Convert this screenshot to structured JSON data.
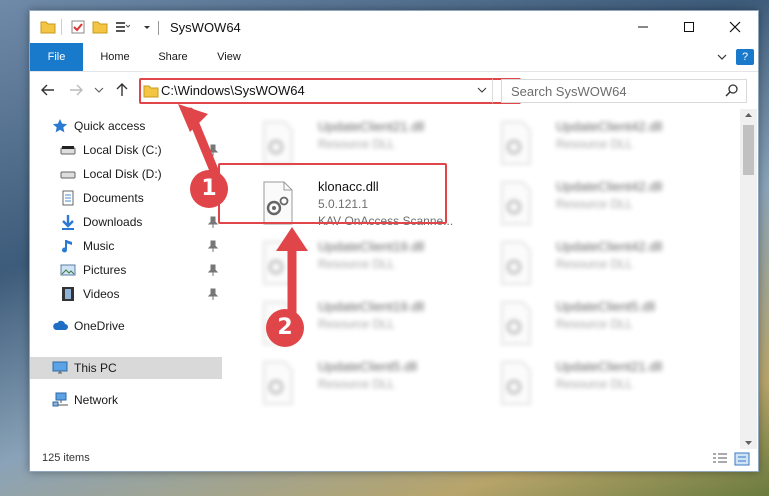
{
  "window": {
    "title": "SysWOW64"
  },
  "ribbon": {
    "tabs": [
      {
        "label": "File"
      },
      {
        "label": "Home"
      },
      {
        "label": "Share"
      },
      {
        "label": "View"
      }
    ],
    "help": "?"
  },
  "nav": {
    "address": "C:\\Windows\\SysWOW64",
    "search_placeholder": "Search SysWOW64"
  },
  "sidebar": {
    "items": [
      {
        "label": "Quick access",
        "icon": "star-icon"
      },
      {
        "label": "Local Disk (C:)",
        "icon": "drive-icon"
      },
      {
        "label": "Local Disk (D:)",
        "icon": "drive-icon"
      },
      {
        "label": "Documents",
        "icon": "documents-icon"
      },
      {
        "label": "Downloads",
        "icon": "download-arrow-icon"
      },
      {
        "label": "Music",
        "icon": "music-note-icon"
      },
      {
        "label": "Pictures",
        "icon": "pictures-icon"
      },
      {
        "label": "Videos",
        "icon": "film-icon"
      },
      {
        "label": "OneDrive",
        "icon": "cloud-icon"
      },
      {
        "label": "This PC",
        "icon": "monitor-icon"
      },
      {
        "label": "Network",
        "icon": "network-icon"
      }
    ]
  },
  "files": {
    "col1": [
      {
        "name": "UpdateClient21.dll",
        "type": "Resource DLL"
      },
      {
        "name": "klonacc.dll",
        "version": "5.0.121.1",
        "description": "KAV OnAccess Scanne..."
      },
      {
        "name": "UpdateClient19.dll",
        "type": "Resource DLL"
      },
      {
        "name": "UpdateClient19.dll",
        "type": "Resource DLL"
      },
      {
        "name": "UpdateClient5.dll",
        "type": "Resource DLL"
      }
    ],
    "col2": [
      {
        "name": "UpdateClient42.dll",
        "type": "Resource DLL"
      },
      {
        "name": "UpdateClient42.dll",
        "type": "Resource DLL"
      },
      {
        "name": "UpdateClient42.dll",
        "type": "Resource DLL"
      },
      {
        "name": "UpdateClient5.dll",
        "type": "Resource DLL"
      },
      {
        "name": "UpdateClient21.dll",
        "type": "Resource DLL"
      }
    ]
  },
  "status": {
    "item_count": "125 items"
  },
  "callouts": {
    "one": "1",
    "two": "2"
  },
  "colors": {
    "accent": "#1979ca",
    "highlight": "#e0454a"
  }
}
